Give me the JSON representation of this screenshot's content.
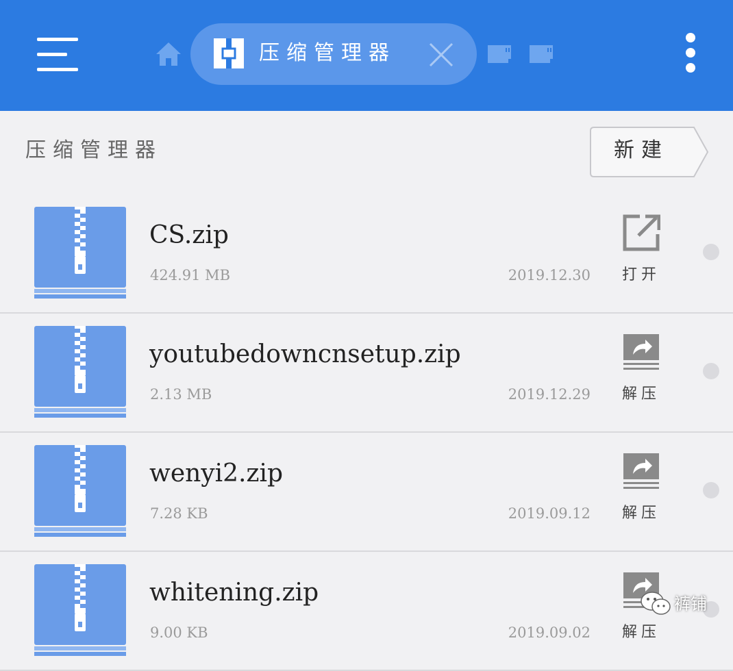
{
  "appbar": {
    "menu_icon": "hamburger-menu-icon",
    "home_icon": "home-icon",
    "active_tab": {
      "label": "压缩管理器",
      "icon": "compress-manager-icon",
      "close_icon": "close-icon"
    },
    "storage_icons": [
      "sd-card-icon",
      "sd-card-icon"
    ],
    "overflow_icon": "more-vert-icon"
  },
  "page": {
    "title": "压缩管理器",
    "new_button_label": "新建"
  },
  "files": [
    {
      "name": "CS.zip",
      "size": "424.91 MB",
      "date": "2019.12.30",
      "action": "打开",
      "action_icon": "open-external-icon"
    },
    {
      "name": "youtubedowncnsetup.zip",
      "size": "2.13 MB",
      "date": "2019.12.29",
      "action": "解压",
      "action_icon": "extract-icon"
    },
    {
      "name": "wenyi2.zip",
      "size": "7.28 KB",
      "date": "2019.09.12",
      "action": "解压",
      "action_icon": "extract-icon"
    },
    {
      "name": "whitening.zip",
      "size": "9.00 KB",
      "date": "2019.09.02",
      "action": "解压",
      "action_icon": "extract-icon"
    }
  ],
  "watermark": {
    "text": "裤铺",
    "icon": "wechat-icon"
  },
  "colors": {
    "appbar": "#2c7be1",
    "tab_active": "#5b97ea",
    "zip_icon": "#6a9ce8",
    "background": "#f1f1f3"
  }
}
